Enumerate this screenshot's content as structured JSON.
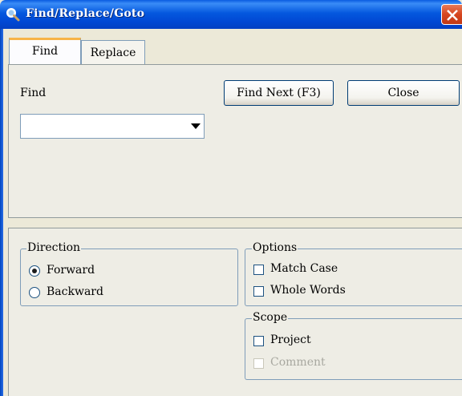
{
  "window": {
    "title": "Find/Replace/Goto",
    "title_icon": "magnifier-icon",
    "close_icon": "close-icon",
    "accent_color": "#0458de",
    "close_color": "#d6461f"
  },
  "tabs": [
    {
      "label": "Find",
      "active": true
    },
    {
      "label": "Replace",
      "active": false
    }
  ],
  "find": {
    "label": "Find",
    "input_value": "",
    "dropdown_icon": "chevron-down-icon"
  },
  "buttons": {
    "find_next": "Find Next (F3)",
    "close": "Close"
  },
  "direction": {
    "legend": "Direction",
    "options": [
      {
        "label": "Forward",
        "selected": true
      },
      {
        "label": "Backward",
        "selected": false
      }
    ]
  },
  "options": {
    "legend": "Options",
    "items": [
      {
        "label": "Match Case",
        "checked": false
      },
      {
        "label": "Whole Words",
        "checked": false
      }
    ]
  },
  "scope": {
    "legend": "Scope",
    "items": [
      {
        "label": "Project",
        "checked": false,
        "enabled": true
      },
      {
        "label": "Comment",
        "checked": false,
        "enabled": false
      }
    ]
  }
}
